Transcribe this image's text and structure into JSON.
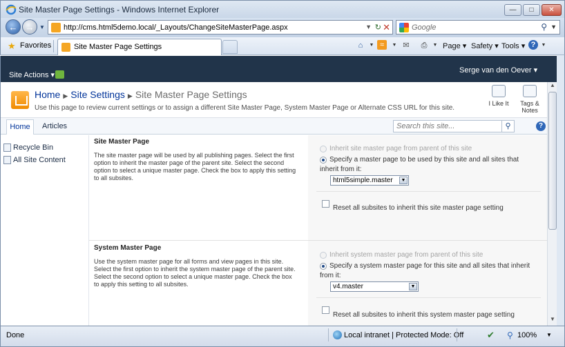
{
  "browser": {
    "window_title": "Site Master Page Settings - Windows Internet Explorer",
    "url": "http://cms.html5demo.local/_Layouts/ChangeSiteMasterPage.aspx",
    "search_placeholder": "Google",
    "favorites_label": "Favorites",
    "tab_title": "Site Master Page Settings",
    "commands": {
      "page": "Page ▾",
      "safety": "Safety ▾",
      "tools": "Tools ▾"
    },
    "status": {
      "left": "Done",
      "zone": "Local intranet | Protected Mode: Off",
      "zoom": "100%"
    }
  },
  "sharepoint": {
    "site_actions": "Site Actions ▾",
    "user": "Serge van den Oever ▾",
    "breadcrumb": {
      "home": "Home",
      "settings": "Site Settings",
      "current": "Site Master Page Settings"
    },
    "description": "Use this page to review current settings or to assign a different Site Master Page, System Master Page or Alternate CSS URL for this site.",
    "tools": {
      "like": "I Like It",
      "tags_1": "Tags &",
      "tags_2": "Notes"
    },
    "nav": {
      "home": "Home",
      "articles": "Articles",
      "search_placeholder": "Search this site..."
    },
    "leftnav": {
      "recycle": "Recycle Bin",
      "content": "All Site Content"
    },
    "site_master": {
      "title": "Site Master Page",
      "desc": "The site master page will be used by all publishing pages. Select the first option to inherit the master page of the parent site. Select the second option to select a unique master page. Check the box to apply this setting to all subsites.",
      "opt_inherit": "Inherit site master page from parent of this site",
      "opt_specify_1": "Specify a master page to be used by this site and all sites that",
      "opt_specify_2": "inherit from it:",
      "selected": "html5simple.master",
      "reset": "Reset all subsites to inherit this site master page setting"
    },
    "system_master": {
      "title": "System Master Page",
      "desc": "Use the system master page for all forms and view pages in this site. Select the first option to inherit the system master page of the parent site. Select the second option to select a unique master page. Check the box to apply this setting to all subsites.",
      "opt_inherit": "Inherit system master page from parent of this site",
      "opt_specify_1": "Specify a system master page for this site and all sites that inherit",
      "opt_specify_2": "from it:",
      "selected": "v4.master",
      "reset": "Reset all subsites to inherit this system master page setting"
    }
  }
}
